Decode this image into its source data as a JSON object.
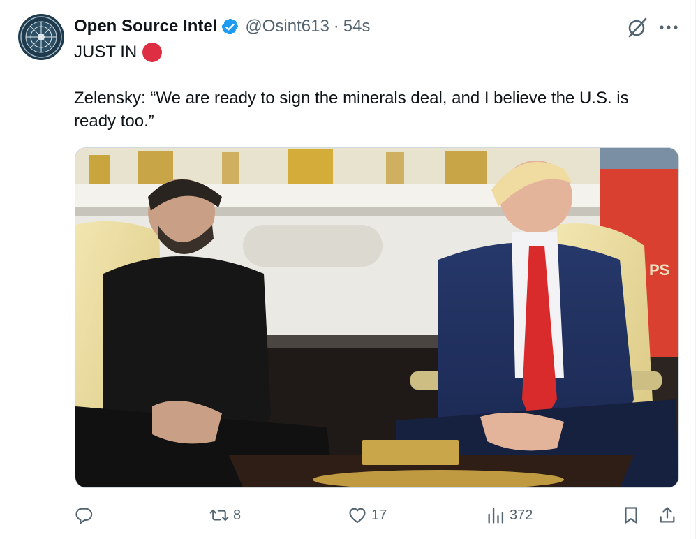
{
  "author": {
    "display_name": "Open Source Intel",
    "handle": "@Osint613",
    "separator": "·",
    "time": "54s",
    "avatar_icon": "osint-logo-avatar",
    "verified_icon": "verified-badge-icon"
  },
  "tweet": {
    "line1": "JUST IN",
    "line1_icon": "red-circle-emoji",
    "text": "Zelensky: “We are ready to sign the minerals deal, and I believe the U.S. is ready too.”"
  },
  "media": {
    "flag_text": "PS"
  },
  "actions": {
    "reply_icon": "reply-icon",
    "replies": "",
    "retweet_icon": "retweet-icon",
    "retweets": "8",
    "like_icon": "heart-icon",
    "likes": "17",
    "views_icon": "views-icon",
    "views": "372",
    "bookmark_icon": "bookmark-icon",
    "share_icon": "share-icon"
  },
  "colors": {
    "accent": "#1d9bf0",
    "text": "#0f1419",
    "muted": "#536471",
    "red_dot": "#dd2e44"
  }
}
